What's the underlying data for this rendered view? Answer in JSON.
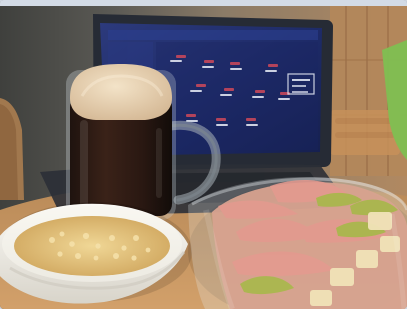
{
  "scene": {
    "objects": [
      "laptop",
      "laptop-screen-diagram",
      "beer-mug",
      "pasta-bowl",
      "meat-salad-bowl",
      "wooden-wall",
      "chair",
      "green-book"
    ],
    "colors": {
      "wall_dark": "#4a4b47",
      "wood": "#b98d5f",
      "table": "#c8955e",
      "laptop_body": "#262b35",
      "screen_bg": "#1f2c69",
      "beer": "#2b1a13",
      "foam": "#e6cfac",
      "bowl": "#f3f1ea",
      "pasta": "#e4c172",
      "ham": "#d98b84",
      "salad_green": "#a7b84a",
      "book_green": "#7fbf52",
      "border": "#d3dbe6"
    }
  }
}
